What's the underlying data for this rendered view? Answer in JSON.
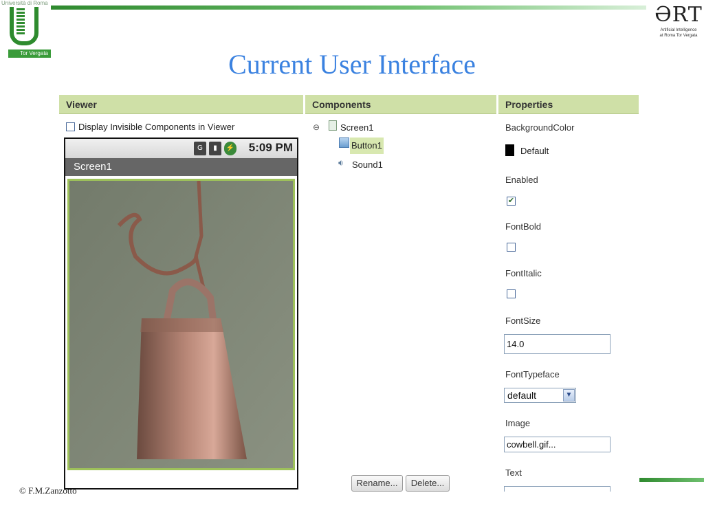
{
  "slide": {
    "title": "Current User Interface",
    "university_top": "Università di Roma",
    "university_band": "Tor Vergata",
    "ai_logo_sub1": "Artificial Intelligence",
    "ai_logo_sub2": "at Roma Tor Vergata",
    "copyright": "© F.M.Zanzotto"
  },
  "panels": {
    "viewer": "Viewer",
    "components": "Components",
    "properties": "Properties"
  },
  "viewer": {
    "display_invisible_label": "Display Invisible Components in Viewer",
    "display_invisible_checked": false,
    "phone": {
      "time": "5:09 PM",
      "screen_title": "Screen1"
    }
  },
  "components": {
    "tree": [
      {
        "label": "Screen1",
        "icon": "screen-icon",
        "expanded": true
      },
      {
        "label": "Button1",
        "icon": "button-icon",
        "selected": true
      },
      {
        "label": "Sound1",
        "icon": "sound-icon"
      }
    ],
    "rename_label": "Rename...",
    "delete_label": "Delete..."
  },
  "properties": {
    "background_color_label": "BackgroundColor",
    "background_color_value": "Default",
    "background_color_swatch": "#000000",
    "enabled_label": "Enabled",
    "enabled_checked": true,
    "fontbold_label": "FontBold",
    "fontbold_checked": false,
    "fontitalic_label": "FontItalic",
    "fontitalic_checked": false,
    "fontsize_label": "FontSize",
    "fontsize_value": "14.0",
    "fonttypeface_label": "FontTypeface",
    "fonttypeface_value": "default",
    "image_label": "Image",
    "image_value": "cowbell.gif...",
    "text_label": "Text",
    "text_value": ""
  },
  "colors": {
    "header_bg": "#cfe0a7",
    "title_blue": "#3b82e0",
    "selection_bg": "#d8e8b0"
  }
}
